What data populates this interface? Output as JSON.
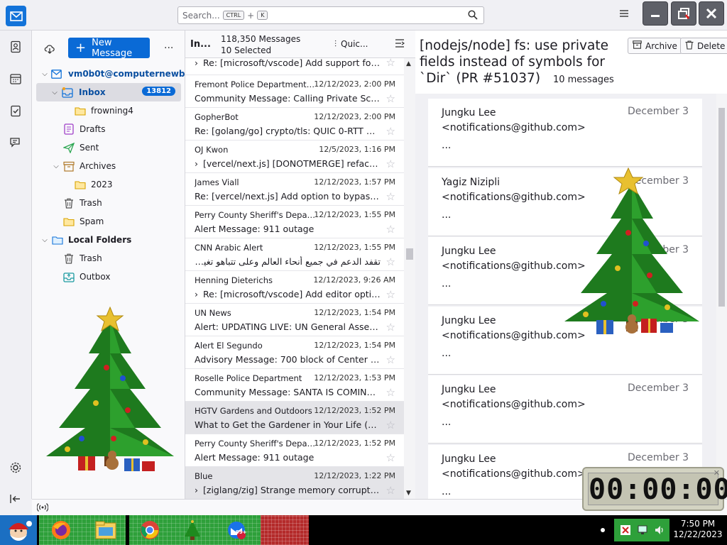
{
  "titlebar": {
    "search_placeholder": "Search...",
    "search_key1": "CTRL",
    "search_plus": "+",
    "search_key2": "K"
  },
  "folder_pane": {
    "new_message_label": "New Message",
    "more_label": "...",
    "folders": [
      {
        "label": "vm0b0t@computernewb...",
        "icon": "mail-account-icon"
      },
      {
        "label": "Inbox",
        "icon": "inbox-icon",
        "badge": "13812"
      },
      {
        "label": "frowning4",
        "icon": "folder-icon"
      },
      {
        "label": "Drafts",
        "icon": "drafts-icon"
      },
      {
        "label": "Sent",
        "icon": "sent-icon"
      },
      {
        "label": "Archives",
        "icon": "archive-icon"
      },
      {
        "label": "2023",
        "icon": "folder-icon"
      },
      {
        "label": "Trash",
        "icon": "trash-icon"
      },
      {
        "label": "Spam",
        "icon": "spam-folder-icon"
      },
      {
        "label": "Local Folders",
        "icon": "local-folder-icon"
      },
      {
        "label": "Trash",
        "icon": "trash-icon"
      },
      {
        "label": "Outbox",
        "icon": "outbox-icon"
      }
    ]
  },
  "message_list": {
    "folder_name": "In...",
    "total": "118,350 Messages",
    "selected": "10 Selected",
    "quick_filter": "Quic...",
    "rows": [
      {
        "sender": "",
        "date": "",
        "subject": "Re: [microsoft/vscode] Add support for ...",
        "thread": true
      },
      {
        "sender": "Fremont Police Department (CA)",
        "date": "12/12/2023, 2:00 PM",
        "subject": "Community Message: Calling Private Scho...",
        "thread": false
      },
      {
        "sender": "GopherBot",
        "date": "12/12/2023, 2:00 PM",
        "subject": "Re: [golang/go] crypto/tls: QUIC 0-RTT API...",
        "thread": false
      },
      {
        "sender": "OJ Kwon",
        "date": "12/5/2023, 1:16 PM",
        "subject": "[vercel/next.js] [DONOTMERGE] refactor...",
        "thread": true
      },
      {
        "sender": "James Viall",
        "date": "12/12/2023, 1:57 PM",
        "subject": "Re: [vercel/next.js] Add option to bypass e...",
        "thread": false
      },
      {
        "sender": "Perry County Sheriff's Departm...",
        "date": "12/12/2023, 1:55 PM",
        "subject": "Alert Message: 911 outage",
        "thread": false
      },
      {
        "sender": "CNN Arabic Alert",
        "date": "12/12/2023, 1:55 PM",
        "subject": "تقفد الدعم في جميع أنحاء العالم وعلى تتباهو تغيير حكومته",
        "thread": false
      },
      {
        "sender": "Henning Dieterichs",
        "date": "12/12/2023, 9:26 AM",
        "subject": "Re: [microsoft/vscode] Add editor optio...",
        "thread": true
      },
      {
        "sender": "UN News",
        "date": "12/12/2023, 1:54 PM",
        "subject": "Alert: UPDATING LIVE: UN General Assemb...",
        "thread": false
      },
      {
        "sender": "Alert El Segundo",
        "date": "12/12/2023, 1:54 PM",
        "subject": "Advisory Message: 700 block of Center Str...",
        "thread": false
      },
      {
        "sender": "Roselle Police Department",
        "date": "12/12/2023, 1:53 PM",
        "subject": "Community Message: SANTA IS COMING T...",
        "thread": false
      },
      {
        "sender": "HGTV Gardens and Outdoors",
        "date": "12/12/2023, 1:52 PM",
        "subject": "What to Get the Gardener in Your Life (or Y...",
        "thread": false,
        "selected": true
      },
      {
        "sender": "Perry County Sheriff's Departm...",
        "date": "12/12/2023, 1:52 PM",
        "subject": "Alert Message: 911 outage",
        "thread": false
      },
      {
        "sender": "Blue",
        "date": "12/12/2023, 1:22 PM",
        "subject": "[ziglang/zig] Strange memory corruptio...",
        "thread": true,
        "selected": true
      }
    ]
  },
  "reading_pane": {
    "title": "[nodejs/node] fs: use private fields instead of symbols for `Dir` (PR #51037)",
    "message_count": "10 messages",
    "archive_label": "Archive",
    "delete_label": "Delete",
    "messages": [
      {
        "author": "Jungku Lee",
        "email": "<notifications@github.com>",
        "date": "December 3",
        "snippet": "..."
      },
      {
        "author": "Yagiz Nizipli",
        "email": "<notifications@github.com>",
        "date": "December 3",
        "snippet": "..."
      },
      {
        "author": "Jungku Lee",
        "email": "<notifications@github.com>",
        "date": "December 3",
        "snippet": "..."
      },
      {
        "author": "Jungku Lee",
        "email": "<notifications@github.com>",
        "date": "December 3",
        "snippet": "..."
      },
      {
        "author": "Jungku Lee",
        "email": "<notifications@github.com>",
        "date": "December 3",
        "snippet": "..."
      },
      {
        "author": "Jungku Lee",
        "email": "<notifications@github.com>",
        "date": "December 3",
        "snippet": "..."
      }
    ]
  },
  "timer": {
    "display": "00:00:00"
  },
  "taskbar": {
    "time": "7:50 PM",
    "date": "12/22/2023",
    "mail_badge": "99+"
  },
  "colors": {
    "accent": "#0a6ad6",
    "taskbar_green": "#2ea03a",
    "taskbar_red": "#b42a2a"
  }
}
